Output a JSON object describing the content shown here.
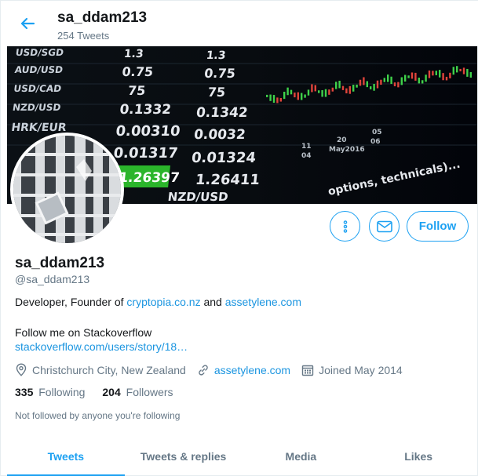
{
  "header": {
    "title": "sa_ddam213",
    "tweet_count": "254 Tweets"
  },
  "banner": {
    "rows": [
      {
        "pair": "USD/SGD",
        "bid": "1.3",
        "ask": "1.3"
      },
      {
        "pair": "AUD/USD",
        "bid": "0.75",
        "ask": "0.75"
      },
      {
        "pair": "USD/CAD",
        "bid": "75",
        "ask": "75"
      },
      {
        "pair": "NZD/USD",
        "bid": "0.1332",
        "ask": "0.1342"
      },
      {
        "pair": "HRK/EUR",
        "bid": "0.00310",
        "ask": "0.0032"
      },
      {
        "pair": "",
        "bid": "0.01317",
        "ask": "0.01324"
      },
      {
        "pair": "",
        "bid": "1.26397",
        "ask": "1.26411"
      }
    ],
    "dates": [
      "11",
      "04",
      "20",
      "May2016",
      "05",
      "06"
    ],
    "caption": "options, technicals)...",
    "ticker": "NZD/USD"
  },
  "profile": {
    "name": "sa_ddam213",
    "handle": "@sa_ddam213",
    "bio_prefix": "Developer, Founder of ",
    "bio_link1": "cryptopia.co.nz",
    "bio_and": " and ",
    "bio_link2": "assetylene.com",
    "bio_line2": "Follow me on Stackoverflow",
    "bio_link3": "stackoverflow.com/users/story/18…",
    "location": "Christchurch City, New Zealand",
    "website": "assetylene.com",
    "joined": "Joined May 2014",
    "following_count": "335",
    "following_label": "Following",
    "followers_count": "204",
    "followers_label": "Followers",
    "not_followed": "Not followed by anyone you're following"
  },
  "actions": {
    "follow_label": "Follow"
  },
  "tabs": [
    {
      "label": "Tweets",
      "active": true
    },
    {
      "label": "Tweets & replies",
      "active": false
    },
    {
      "label": "Media",
      "active": false
    },
    {
      "label": "Likes",
      "active": false
    }
  ],
  "colors": {
    "accent": "#1da1f2",
    "link": "#1b95e0",
    "muted": "#657786",
    "text": "#14171a",
    "ticker_green": "#2bb52b"
  }
}
